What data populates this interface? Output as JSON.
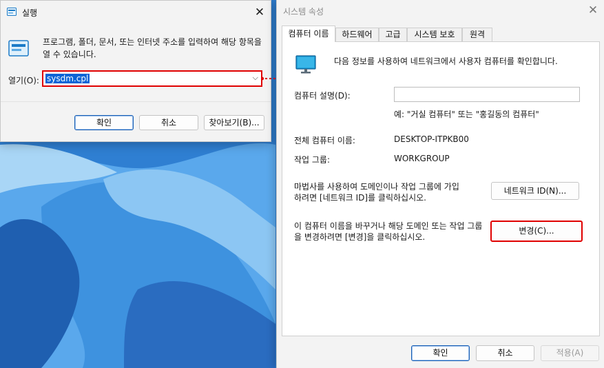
{
  "run_dialog": {
    "title": "실행",
    "description": "프로그램, 폴더, 문서, 또는 인터넷 주소를 입력하여 해당 항목을 열 수 있습니다.",
    "open_label": "열기(O):",
    "open_value": "sysdm.cpl",
    "ok_label": "확인",
    "cancel_label": "취소",
    "browse_label": "찾아보기(B)..."
  },
  "system_properties": {
    "title": "시스템 속성",
    "tabs": [
      "컴퓨터 이름",
      "하드웨어",
      "고급",
      "시스템 보호",
      "원격"
    ],
    "active_tab": "컴퓨터 이름",
    "intro": "다음 정보를 사용하여 네트워크에서 사용자 컴퓨터를 확인합니다.",
    "description_label": "컴퓨터 설명(D):",
    "description_value": "",
    "description_example": "예: \"거실 컴퓨터\" 또는 \"홍길동의 컴퓨터\"",
    "full_name_label": "전체 컴퓨터 이름:",
    "full_name_value": "DESKTOP-ITPKB00",
    "workgroup_label": "작업 그룹:",
    "workgroup_value": "WORKGROUP",
    "network_id_text": "마법사를 사용하여 도메인이나 작업 그룹에 가입하려면 [네트워크 ID]를 클릭하십시오.",
    "network_id_button": "네트워크 ID(N)...",
    "rename_text": "이 컴퓨터 이름을 바꾸거나 해당 도메인 또는 작업 그룹을 변경하려면 [변경]을 클릭하십시오.",
    "change_button": "변경(C)...",
    "ok_label": "확인",
    "cancel_label": "취소",
    "apply_label": "적용(A)"
  },
  "colors": {
    "highlight": "#e00000",
    "selection": "#0a64d6"
  }
}
